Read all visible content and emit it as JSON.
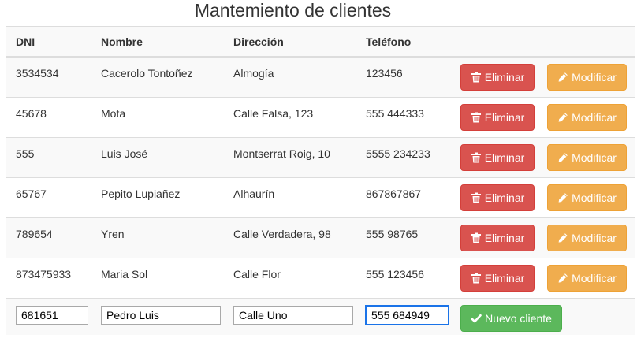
{
  "page": {
    "title": "Mantemiento de clientes"
  },
  "table": {
    "headers": [
      "DNI",
      "Nombre",
      "Dirección",
      "Teléfono"
    ],
    "rows": [
      {
        "dni": "3534534",
        "nombre": "Cacerolo Tontoñez",
        "direccion": "Almogía",
        "telefono": "123456"
      },
      {
        "dni": "45678",
        "nombre": "Mota",
        "direccion": "Calle Falsa, 123",
        "telefono": "555 444333"
      },
      {
        "dni": "555",
        "nombre": "Luis José",
        "direccion": "Montserrat Roig, 10",
        "telefono": "5555 234233"
      },
      {
        "dni": "65767",
        "nombre": "Pepito Lupiañez",
        "direccion": "Alhaurín",
        "telefono": "867867867"
      },
      {
        "dni": "789654",
        "nombre": "Yren",
        "direccion": "Calle Verdadera, 98",
        "telefono": "555 98765"
      },
      {
        "dni": "873475933",
        "nombre": "Maria Sol",
        "direccion": "Calle Flor",
        "telefono": "555 123456"
      }
    ],
    "actions": {
      "delete_label": "Eliminar",
      "edit_label": "Modificar"
    }
  },
  "form": {
    "dni": "681651",
    "nombre": "Pedro Luis",
    "direccion": "Calle Uno",
    "telefono": "555 684949",
    "submit_label": "Nuevo cliente"
  },
  "colors": {
    "danger": "#d9534f",
    "warning": "#f0ad4e",
    "success": "#5cb85c"
  },
  "icons": {
    "delete": "trash-icon",
    "edit": "pencil-icon",
    "submit": "check-icon"
  }
}
